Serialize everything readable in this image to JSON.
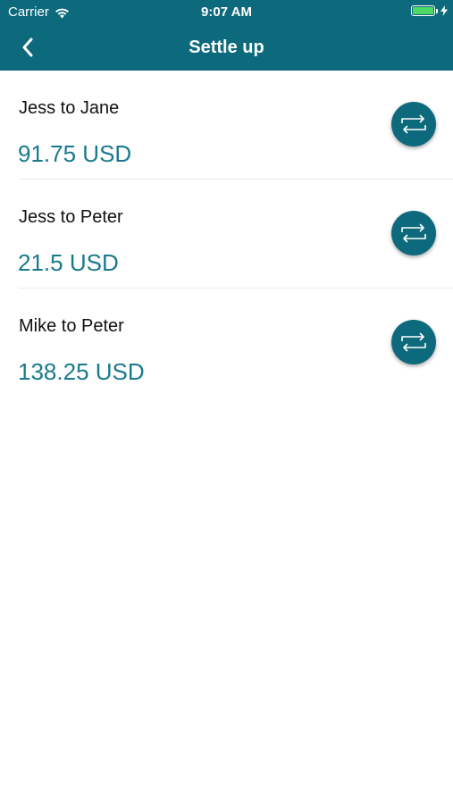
{
  "status_bar": {
    "carrier": "Carrier",
    "time": "9:07 AM",
    "battery_color": "#4cd964"
  },
  "nav": {
    "title": "Settle up",
    "back_icon": "chevron-left-icon"
  },
  "colors": {
    "header": "#0d6a7d",
    "amount_text": "#1a7a8d",
    "action_button": "#0d6a7d"
  },
  "settlements": [
    {
      "label": "Jess to Jane",
      "amount": "91.75 USD",
      "action_icon": "repeat-icon"
    },
    {
      "label": "Jess to Peter",
      "amount": "21.5 USD",
      "action_icon": "repeat-icon"
    },
    {
      "label": "Mike to Peter",
      "amount": "138.25 USD",
      "action_icon": "repeat-icon"
    }
  ]
}
